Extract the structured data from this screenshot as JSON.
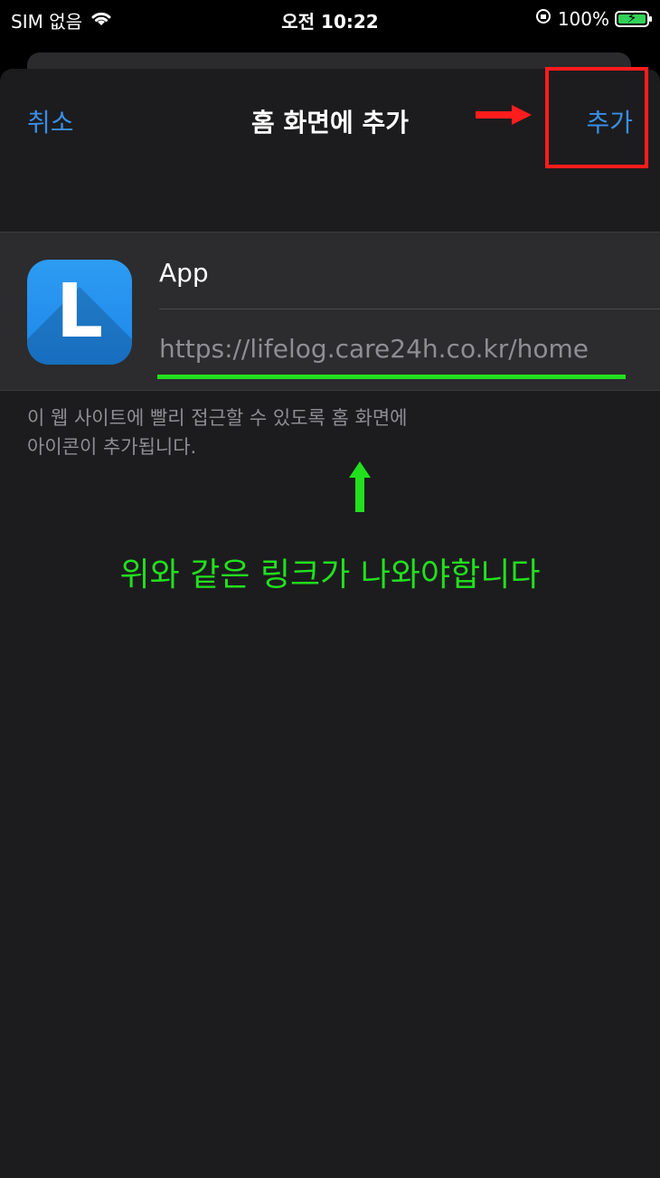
{
  "status_bar": {
    "carrier": "SIM 없음",
    "time": "오전 10:22",
    "battery_percent": "100%"
  },
  "nav": {
    "cancel_label": "취소",
    "title": "홈 화면에 추가",
    "add_label": "추가"
  },
  "app": {
    "icon_letter": "L",
    "name": "App",
    "url": "https://lifelog.care24h.co.kr/home"
  },
  "description": [
    "이 웹 사이트에 빨리 접근할 수 있도록 홈 화면에",
    "아이콘이 추가됩니다."
  ],
  "annotation_text": "위와 같은 링크가 나와야합니다",
  "colors": {
    "accent": "#3a8ee6",
    "annotation_green": "#22e01e",
    "annotation_red": "#ff1c1c"
  }
}
